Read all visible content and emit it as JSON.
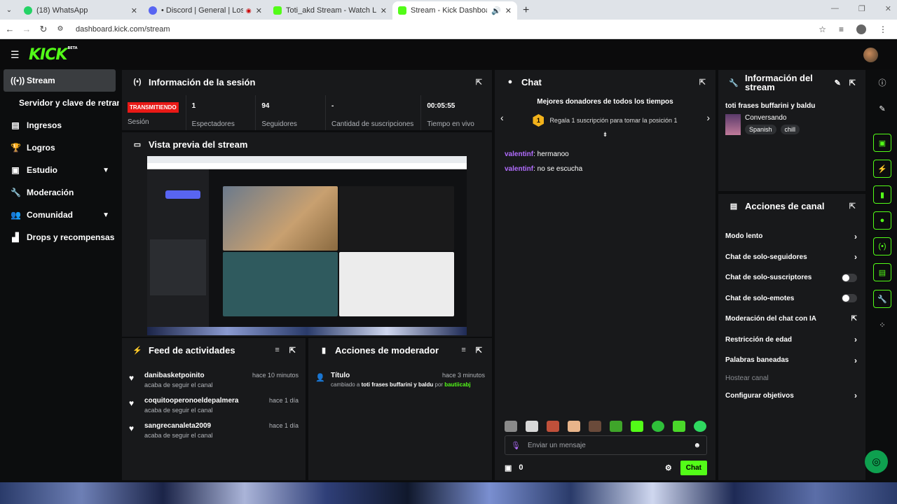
{
  "browser": {
    "tabs": [
      {
        "title": "(18) WhatsApp",
        "fav_color": "#25d366",
        "active": false
      },
      {
        "title": "• Discord | General | Los arg",
        "fav_color": "#5865f2",
        "active": false
      },
      {
        "title": "Toti_akd Stream - Watch Live o",
        "fav_color": "#53fc18",
        "active": false
      },
      {
        "title": "Stream - Kick Dashboard",
        "fav_color": "#53fc18",
        "active": true
      }
    ],
    "url": "dashboard.kick.com/stream"
  },
  "header": {
    "logo": "KICK",
    "logo_sup": "BETA"
  },
  "sidebar": {
    "items": [
      {
        "label": "Stream",
        "icon": "broadcast-icon",
        "active": true
      },
      {
        "label": "Servidor y clave de retransmisión",
        "icon": "",
        "plain": true
      },
      {
        "label": "Ingresos",
        "icon": "income-icon"
      },
      {
        "label": "Logros",
        "icon": "trophy-icon"
      },
      {
        "label": "Estudio",
        "icon": "studio-icon",
        "chevron": true
      },
      {
        "label": "Moderación",
        "icon": "wrench-icon"
      },
      {
        "label": "Comunidad",
        "icon": "community-icon",
        "chevron": true
      },
      {
        "label": "Drops y recompensas",
        "icon": "drops-icon"
      }
    ]
  },
  "session": {
    "title": "Información de la sesión",
    "live_badge": "TRANSMITIENDO",
    "live_label": "Sesión",
    "stats": [
      {
        "value": "1",
        "label": "Espectadores"
      },
      {
        "value": "94",
        "label": "Seguidores"
      },
      {
        "value": "-",
        "label": "Cantidad de suscripciones"
      },
      {
        "value": "00:05:55",
        "label": "Tiempo en vivo"
      }
    ]
  },
  "preview": {
    "title": "Vista previa del stream"
  },
  "feed": {
    "title": "Feed de actividades",
    "items": [
      {
        "name": "danibasketpoinito",
        "sub": "acaba de seguir el canal",
        "time": "hace 10 minutos"
      },
      {
        "name": "coquitooperonoeldepalmera",
        "sub": "acaba de seguir el canal",
        "time": "hace 1 día"
      },
      {
        "name": "sangrecanaleta2009",
        "sub": "acaba de seguir el canal",
        "time": "hace 1 día"
      }
    ]
  },
  "modactions": {
    "title": "Acciones de moderador",
    "item": {
      "title": "Título",
      "time": "hace 3 minutos",
      "prefix": "cambiado a ",
      "value": "toti frases buffarini y baldu",
      "by": " por ",
      "user": "bautiicabj"
    }
  },
  "chat": {
    "title": "Chat",
    "donors_title": "Mejores donadores de todos los tiempos",
    "donor_rank": "1",
    "donor_text": "Regala 1 suscripción para tomar la posición 1",
    "messages": [
      {
        "user": "valentinf",
        "text": ": hermanoo"
      },
      {
        "user": "valentinf",
        "text": ": no se escucha"
      }
    ],
    "input_placeholder": "Enviar un mensaje",
    "points": "0",
    "send_label": "Chat"
  },
  "streaminfo": {
    "title": "Información del stream",
    "stream_title": "toti frases buffarini y baldu",
    "category": "Conversando",
    "tags": [
      "Spanish",
      "chill"
    ]
  },
  "channel_actions": {
    "title": "Acciones de canal",
    "rows": [
      {
        "label": "Modo lento",
        "control": "chevron"
      },
      {
        "label": "Chat de solo-seguidores",
        "control": "chevron"
      },
      {
        "label": "Chat de solo-suscriptores",
        "control": "toggle"
      },
      {
        "label": "Chat de solo-emotes",
        "control": "toggle"
      },
      {
        "label": "Moderación del chat con IA",
        "control": "external"
      },
      {
        "label": "Restricción de edad",
        "control": "chevron"
      },
      {
        "label": "Palabras baneadas",
        "control": "chevron"
      },
      {
        "label": "Hostear canal",
        "control": "none",
        "disabled": true
      },
      {
        "label": "Configurar objetivos",
        "control": "chevron"
      }
    ]
  },
  "colors": {
    "accent": "#53fc18",
    "live": "#e91916",
    "username": "#b26dff",
    "panel": "#18191b"
  }
}
